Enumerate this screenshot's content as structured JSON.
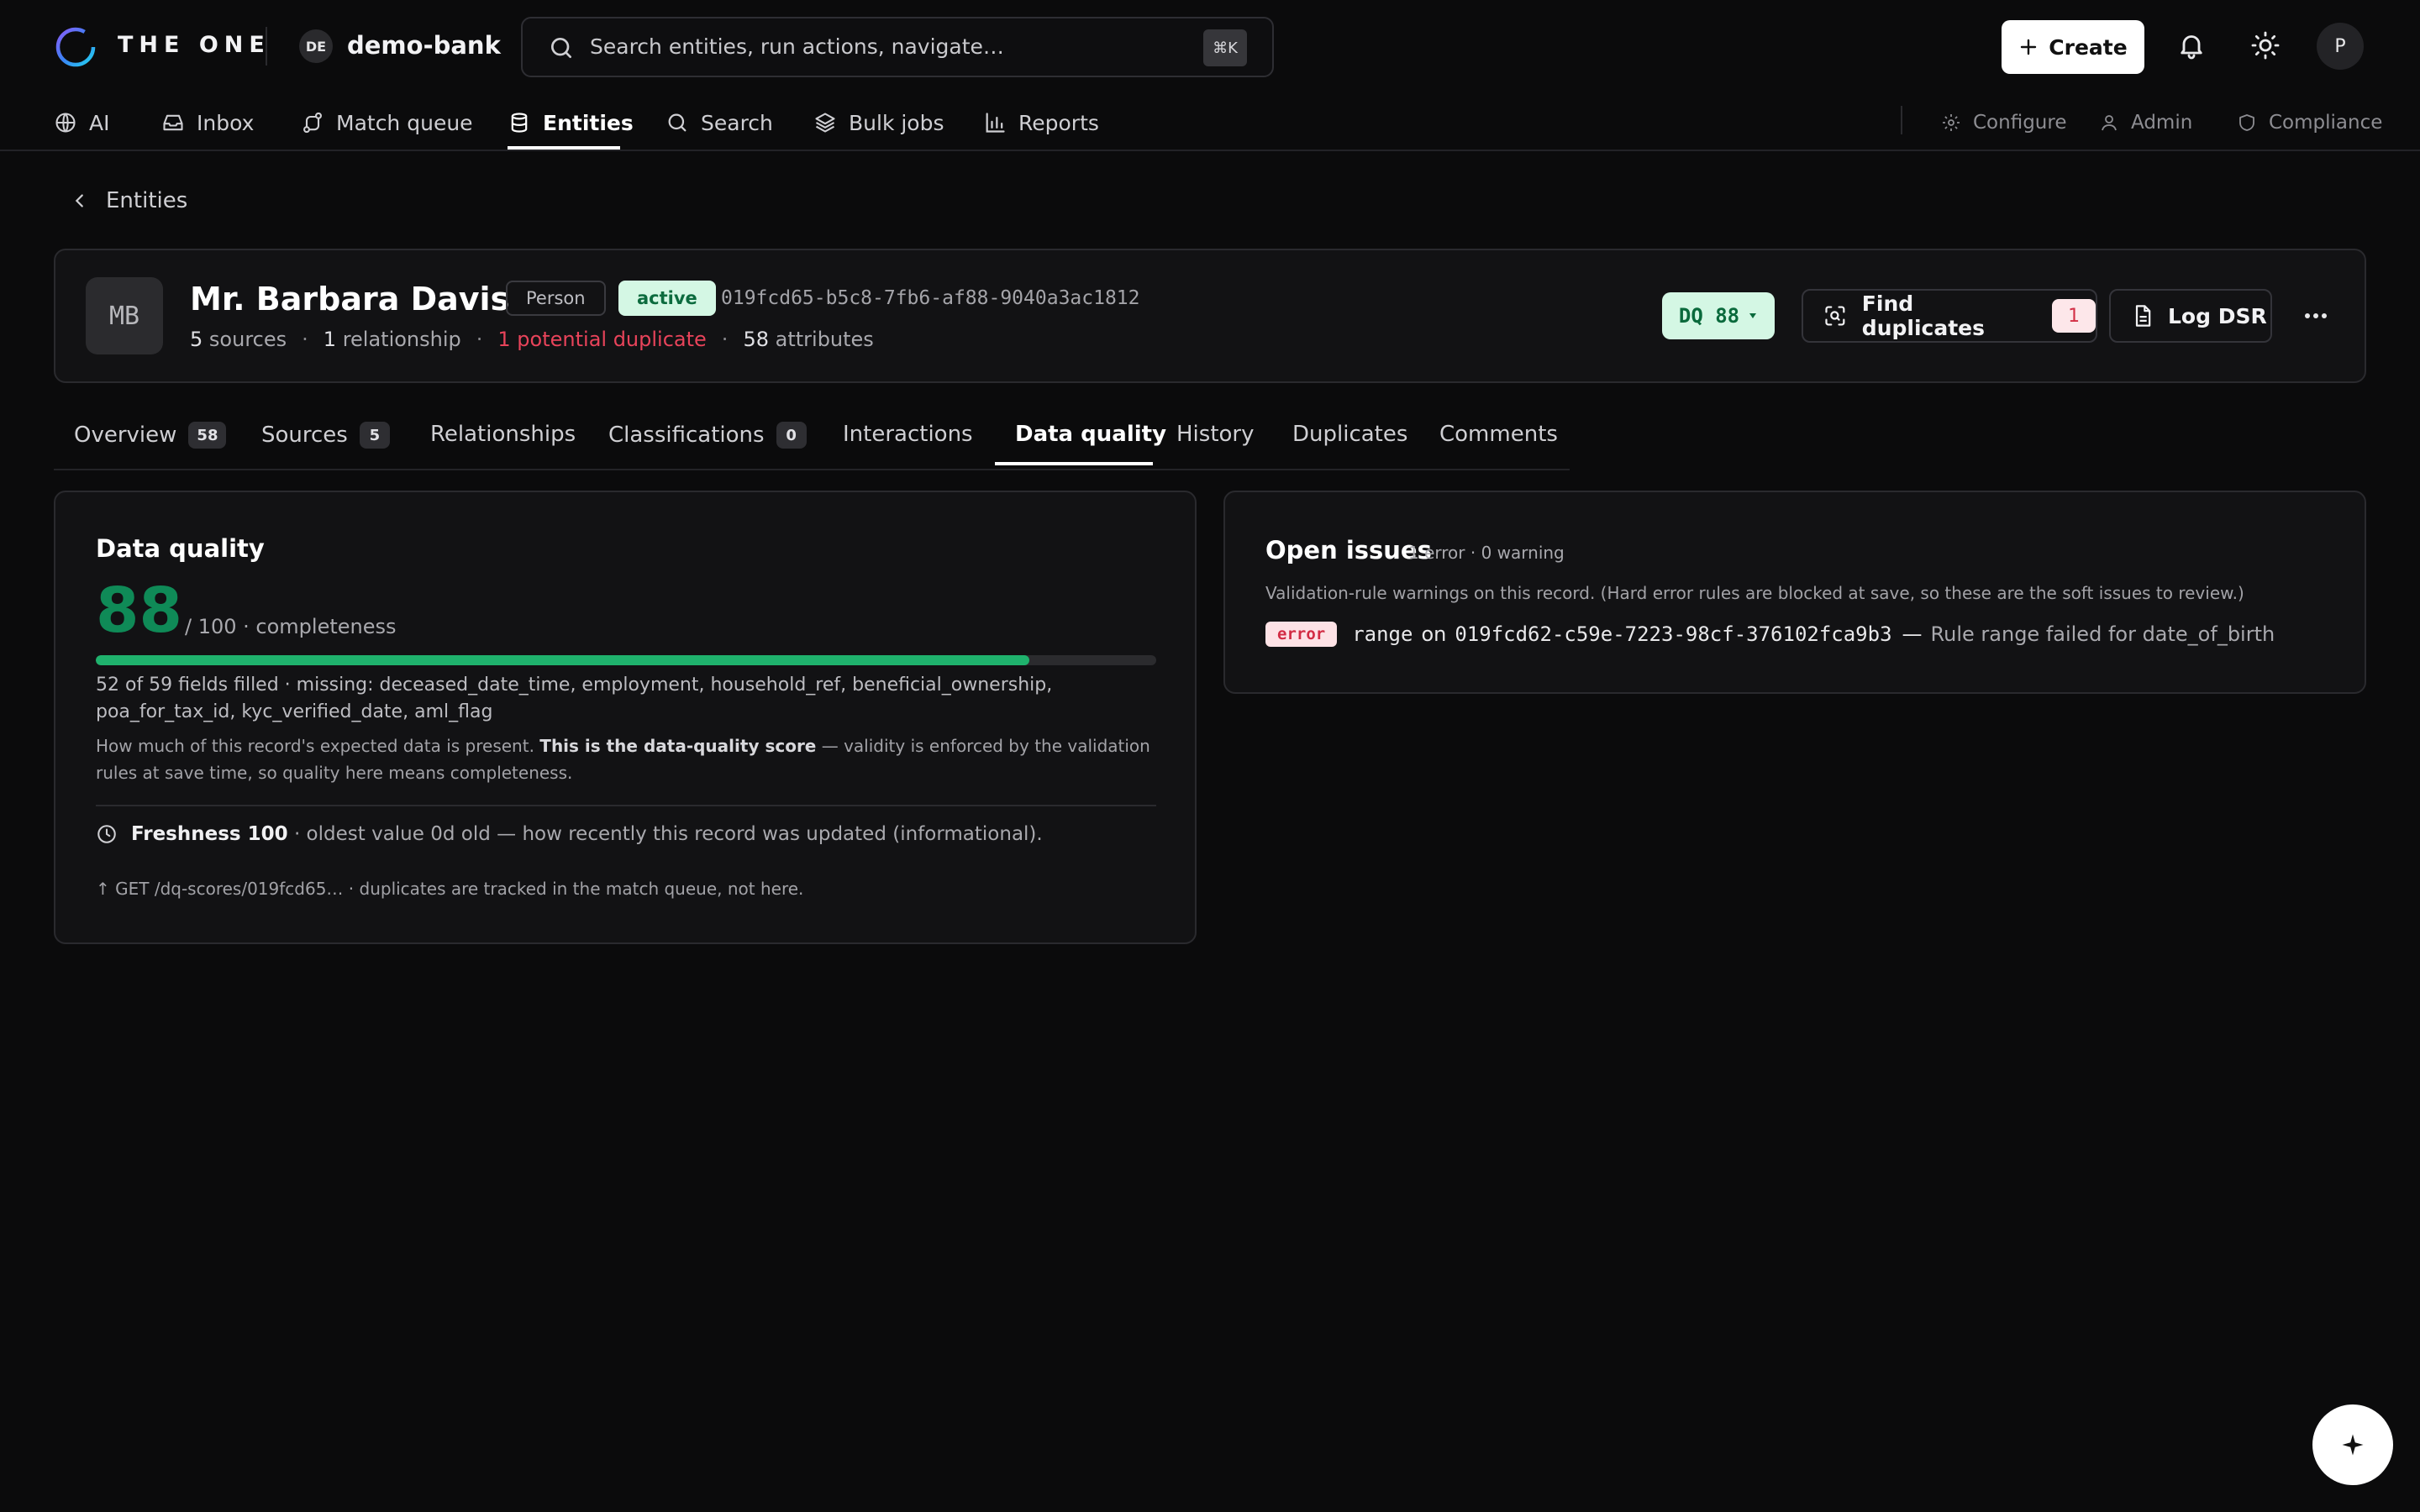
{
  "app": {
    "brand": "THE ONE",
    "workspace_initials": "DE",
    "workspace_name": "demo-bank"
  },
  "search": {
    "placeholder": "Search entities, run actions, navigate…",
    "shortcut": "⌘K"
  },
  "header": {
    "create_label": "Create",
    "user_initial": "P"
  },
  "nav": {
    "items": [
      {
        "label": "AI",
        "icon": "globe-icon"
      },
      {
        "label": "Inbox",
        "icon": "inbox-icon"
      },
      {
        "label": "Match queue",
        "icon": "route-icon"
      },
      {
        "label": "Entities",
        "icon": "database-icon",
        "active": true
      },
      {
        "label": "Search",
        "icon": "search-icon"
      },
      {
        "label": "Bulk jobs",
        "icon": "layers-icon"
      },
      {
        "label": "Reports",
        "icon": "bar-chart-icon"
      }
    ],
    "right": [
      {
        "label": "Configure",
        "icon": "gear-icon"
      },
      {
        "label": "Admin",
        "icon": "user-icon"
      },
      {
        "label": "Compliance",
        "icon": "shield-icon"
      }
    ]
  },
  "breadcrumb": {
    "back_label": "Entities"
  },
  "entity": {
    "initials": "MB",
    "name": "Mr. Barbara Davis",
    "type": "Person",
    "status": "active",
    "uuid": "019fcd65-b5c8-7fb6-af88-9040a3ac1812",
    "meta": {
      "sources_count": "5",
      "sources_label": "sources",
      "rel_count": "1",
      "rel_label": "relationship",
      "dup_text": "1 potential duplicate",
      "attr_count": "58",
      "attr_label": "attributes"
    },
    "dq_chip": "DQ 88",
    "find_duplicates_label": "Find duplicates",
    "find_duplicates_count": "1",
    "log_dsr_label": "Log DSR"
  },
  "tabs": [
    {
      "label": "Overview",
      "count": "58"
    },
    {
      "label": "Sources",
      "count": "5"
    },
    {
      "label": "Relationships"
    },
    {
      "label": "Classifications",
      "count": "0"
    },
    {
      "label": "Interactions"
    },
    {
      "label": "Data quality",
      "active": true
    },
    {
      "label": "History"
    },
    {
      "label": "Duplicates"
    },
    {
      "label": "Comments"
    }
  ],
  "dq": {
    "title": "Data quality",
    "score": "88",
    "score_suffix": "/ 100 · completeness",
    "fill_fraction": 0.88,
    "fields_text": "52 of 59 fields filled · missing: deceased_date_time, employment, household_ref, beneficial_ownership, poa_for_tax_id, kyc_verified_date, aml_flag",
    "desc_prefix": "How much of this record's expected data is present. ",
    "desc_strong": "This is the data-quality score",
    "desc_suffix": " — validity is enforced by the validation rules at save time, so quality here means completeness.",
    "freshness_label": "Freshness 100",
    "freshness_text": "· oldest value 0d old — how recently this record was updated (informational).",
    "get_text": "↑ GET /dq-scores/019fcd65… · duplicates are tracked in the match queue, not here."
  },
  "issues": {
    "title": "Open issues",
    "count_text": "1 error · 0 warning",
    "desc": "Validation-rule warnings on this record. (Hard error rules are blocked at save, so these are the soft issues to review.)",
    "row": {
      "severity": "error",
      "rule": "range",
      "on_label": "on",
      "target": "019fcd62-c59e-7223-98cf-376102fca9b3",
      "dash": "—",
      "message": "Rule range failed for date_of_birth"
    }
  },
  "colors": {
    "accent_green": "#1fb26d",
    "danger": "#e8435a",
    "background": "#0b0b0c"
  }
}
